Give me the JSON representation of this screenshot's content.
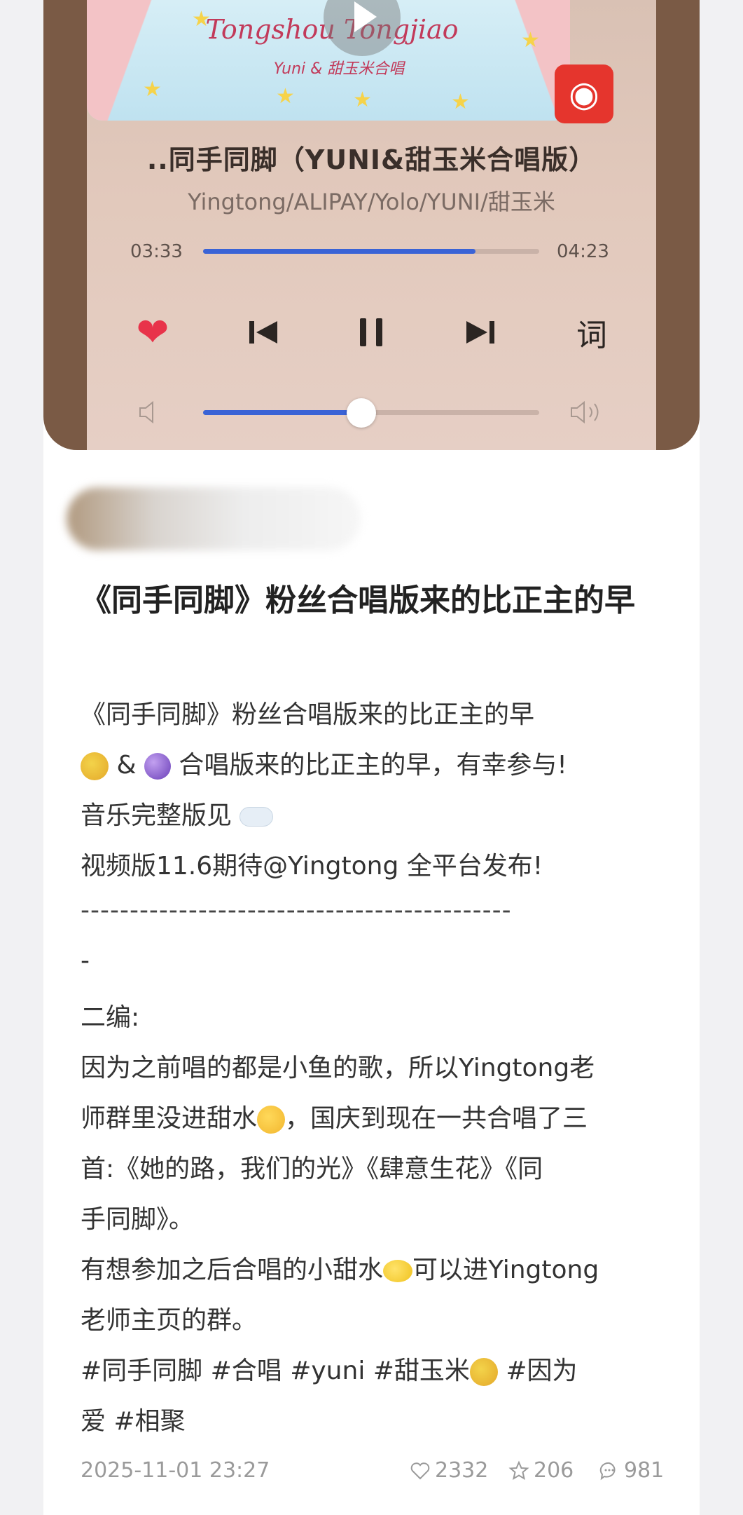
{
  "player": {
    "cover_title": "Tongshou Tongjiao",
    "cover_subtitle": "Yuni & 甜玉米合唱",
    "song_title": "..同手同脚（YUNI&甜玉米合唱版）",
    "artists": "Yingtong/ALIPAY/Yolo/YUNI/甜玉米",
    "current_time": "03:33",
    "total_time": "04:23",
    "progress": 0.81,
    "volume": 0.47,
    "liked": true,
    "lyrics_label": "词",
    "icons": [
      "play-icon",
      "netease-music-icon",
      "heart-icon",
      "previous-icon",
      "pause-icon",
      "next-icon",
      "volume-low-icon",
      "volume-high-icon"
    ],
    "colors": {
      "accent": "#3a63d6",
      "heart": "#e8334a",
      "netease": "#e5352d"
    }
  },
  "post": {
    "title": "《同手同脚》粉丝合唱版来的比正主的早",
    "lines": [
      "《同手同脚》粉丝合唱版来的比正主的早",
      "& ",
      "合唱版来的比正主的早，有幸参与!",
      "音乐完整版见",
      "视频版11.6期待@Yingtong 全平台发布!",
      "--------------------------------------------",
      "-",
      "二编:",
      "因为之前唱的都是小鱼的歌，所以Yingtong老",
      "师群里没进甜水",
      "，国庆到现在一共合唱了三",
      "首:《她的路，我们的光》《肆意生花》《同",
      "手同脚》。",
      "有想参加之后合唱的小甜水",
      "可以进Yingtong",
      "老师主页的群。",
      "#同手同脚 #合唱 #yuni #甜玉米",
      " #因为",
      "爱 #相聚"
    ],
    "date": "2025-11-01 23:27",
    "likes": "2332",
    "favorites": "206",
    "comments": "981"
  }
}
